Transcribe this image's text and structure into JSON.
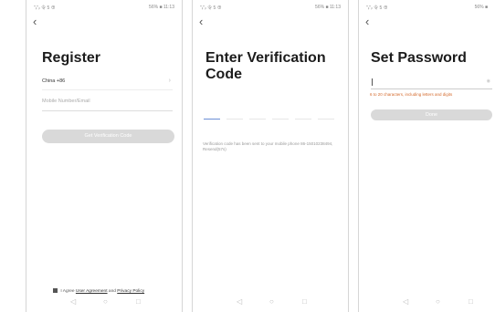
{
  "status": {
    "left": "\"ᵢₗ\"ᵢₗ 令 5 ⊕",
    "right": "56% ■ 11:13",
    "right_short": "56% ■"
  },
  "register": {
    "title": "Register",
    "country": "China +86",
    "phone_placeholder": "Mobile Number/Email",
    "get_code_button": "Get Verification Code",
    "agree_prefix": "I Agree",
    "user_agreement": "User Agreement",
    "and": "and",
    "privacy_policy": "Privacy Policy"
  },
  "verify": {
    "title": "Enter Verification Code",
    "message": "Verification code has been sent to your mobile phone 86-15010238494, Resend(57s)"
  },
  "password": {
    "title": "Set Password",
    "hint": "6 to 20 characters, including letters and digits",
    "done_button": "Done"
  },
  "nav": {
    "back": "◁",
    "home": "○",
    "recent": "□"
  },
  "colors": {
    "accent": "#6b8fd6",
    "disabled_button": "#d9d9d9",
    "hint": "#d46a2d"
  }
}
